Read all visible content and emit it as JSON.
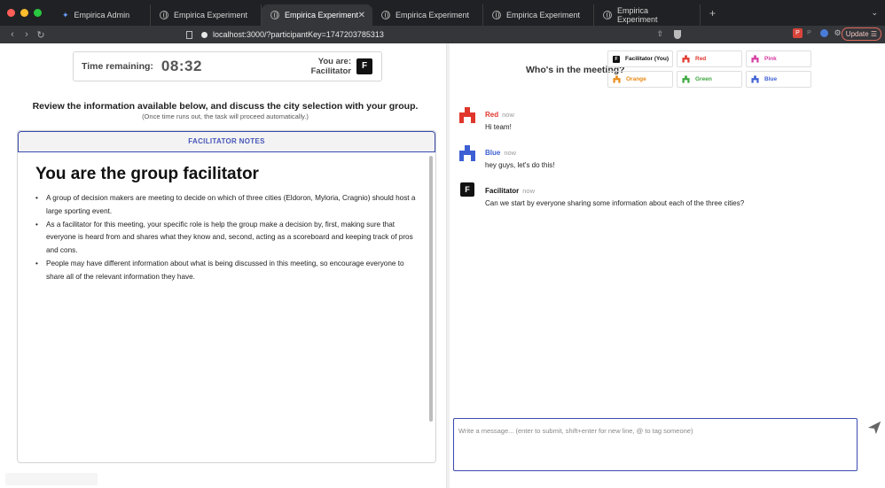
{
  "browser": {
    "tabs": [
      {
        "label": "Empirica Admin",
        "active": false
      },
      {
        "label": "Empirica Experiment",
        "active": false
      },
      {
        "label": "Empirica Experiment",
        "active": true
      },
      {
        "label": "Empirica Experiment",
        "active": false
      },
      {
        "label": "Empirica Experiment",
        "active": false
      },
      {
        "label": "Empirica Experiment",
        "active": false
      }
    ],
    "url": "localhost:3000/?participantKey=1747203785313",
    "update_label": "Update"
  },
  "timer": {
    "label": "Time remaining:",
    "value": "08:32"
  },
  "identity": {
    "line1": "You are:",
    "line2": "Facilitator",
    "badge": "F"
  },
  "instructions": {
    "main": "Review the information available below, and discuss the city selection with your group.",
    "sub": "(Once time runs out, the task will proceed automatically.)"
  },
  "notes": {
    "header": "FACILITATOR NOTES",
    "title": "You are the group facilitator",
    "items": [
      "A group of decision makers are meeting to decide on which of three cities (Eldoron, Myloria, Cragnio) should host a large sporting event.",
      "As a facilitator for this meeting, your specific role is help the group make a decision by, first, making sure that everyone is heard from and shares what they know and, second, acting as a scoreboard and keeping track of pros and cons.",
      "People may have different information about what is being discussed in this meeting, so encourage everyone to share all of the relevant information they have."
    ]
  },
  "meeting": {
    "label": "Who's in the meeting?",
    "participants": [
      {
        "name": "Facilitator (You)",
        "color": "#111111",
        "kind": "facilitator"
      },
      {
        "name": "Red",
        "color": "#e0362c",
        "kind": "avatar"
      },
      {
        "name": "Pink",
        "color": "#d63aa0",
        "kind": "avatar"
      },
      {
        "name": "Orange",
        "color": "#e98a17",
        "kind": "avatar"
      },
      {
        "name": "Green",
        "color": "#3aa53c",
        "kind": "avatar"
      },
      {
        "name": "Blue",
        "color": "#3d5fd4",
        "kind": "avatar"
      }
    ]
  },
  "chat": {
    "messages": [
      {
        "name": "Red",
        "time": "now",
        "text": "Hi team!",
        "color": "#e0362c"
      },
      {
        "name": "Blue",
        "time": "now",
        "text": "hey guys, let's do this!",
        "color": "#3d5fd4"
      },
      {
        "name": "Facilitator",
        "time": "now",
        "text": "Can we start by everyone sharing some information about each of the three cities?",
        "color": "#111111"
      }
    ],
    "placeholder": "Write a message... (enter to submit, shift+enter for new line, @ to tag someone)"
  },
  "icons": {
    "avatar": "avatar-icon",
    "send": "send-icon"
  }
}
